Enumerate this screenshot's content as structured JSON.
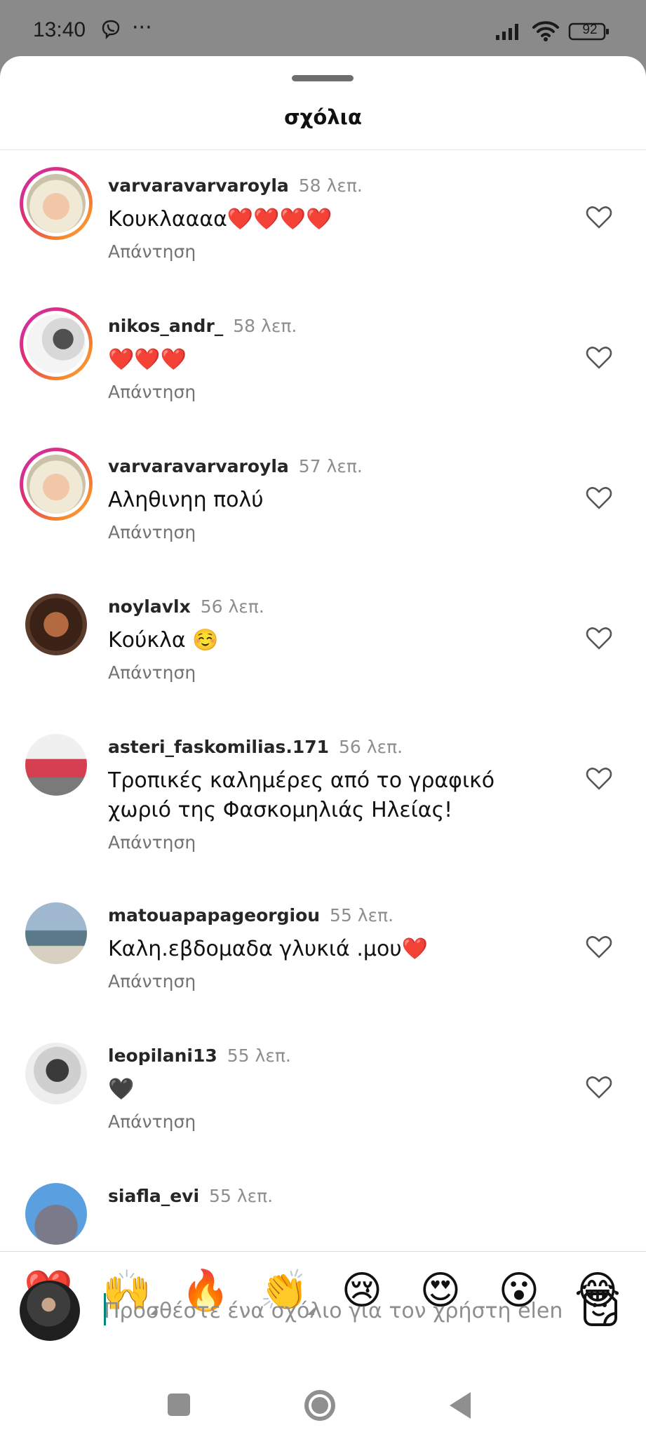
{
  "status_bar": {
    "time": "13:40",
    "more": "···",
    "battery": "92"
  },
  "sheet": {
    "title": "σχόλια"
  },
  "comments": [
    {
      "username": "varvaravarvaroyla",
      "time": "58 λεπ.",
      "text": "Κουκλαααα❤️❤️❤️❤️",
      "reply": "Απάντηση"
    },
    {
      "username": "nikos_andr_",
      "time": "58 λεπ.",
      "text": "❤️❤️❤️",
      "reply": "Απάντηση"
    },
    {
      "username": "varvaravarvaroyla",
      "time": "57 λεπ.",
      "text": "Αληθινηη πολύ",
      "reply": "Απάντηση"
    },
    {
      "username": "noylavlx",
      "time": "56 λεπ.",
      "text": "Κούκλα ☺️",
      "reply": "Απάντηση"
    },
    {
      "username": "asteri_faskomilias.171",
      "time": "56 λεπ.",
      "text": "Τροπικές καλημέρες από το γραφικό χωριό της Φασκομηλιάς Ηλείας!",
      "reply": "Απάντηση"
    },
    {
      "username": "matouapapageorgiou",
      "time": "55 λεπ.",
      "text": "Καλη.εβδομαδα γλυκιά .μου❤️",
      "reply": "Απάντηση"
    },
    {
      "username": "leopilani13",
      "time": "55 λεπ.",
      "text": "🖤",
      "reply": "Απάντηση"
    },
    {
      "username": "siafla_evi",
      "time": "55 λεπ.",
      "text": "",
      "reply": ""
    }
  ],
  "reactions": [
    "❤️",
    "🙌",
    "🔥",
    "👏",
    "😢",
    "😍",
    "😮",
    "😂"
  ],
  "composer": {
    "placeholder": "Προσθέστε ένα σχόλιο για τον χρήστη elen"
  },
  "icons": {
    "like": "heart-outline-icon",
    "sticker": "sticker-icon",
    "nav": [
      "recents-square-icon",
      "home-circle-icon",
      "back-triangle-icon"
    ]
  },
  "colors": {
    "story_ring_start": "#c931b5",
    "story_ring_end": "#fbad50",
    "secondary_text": "#8e8e8e",
    "caret": "#00897b"
  }
}
